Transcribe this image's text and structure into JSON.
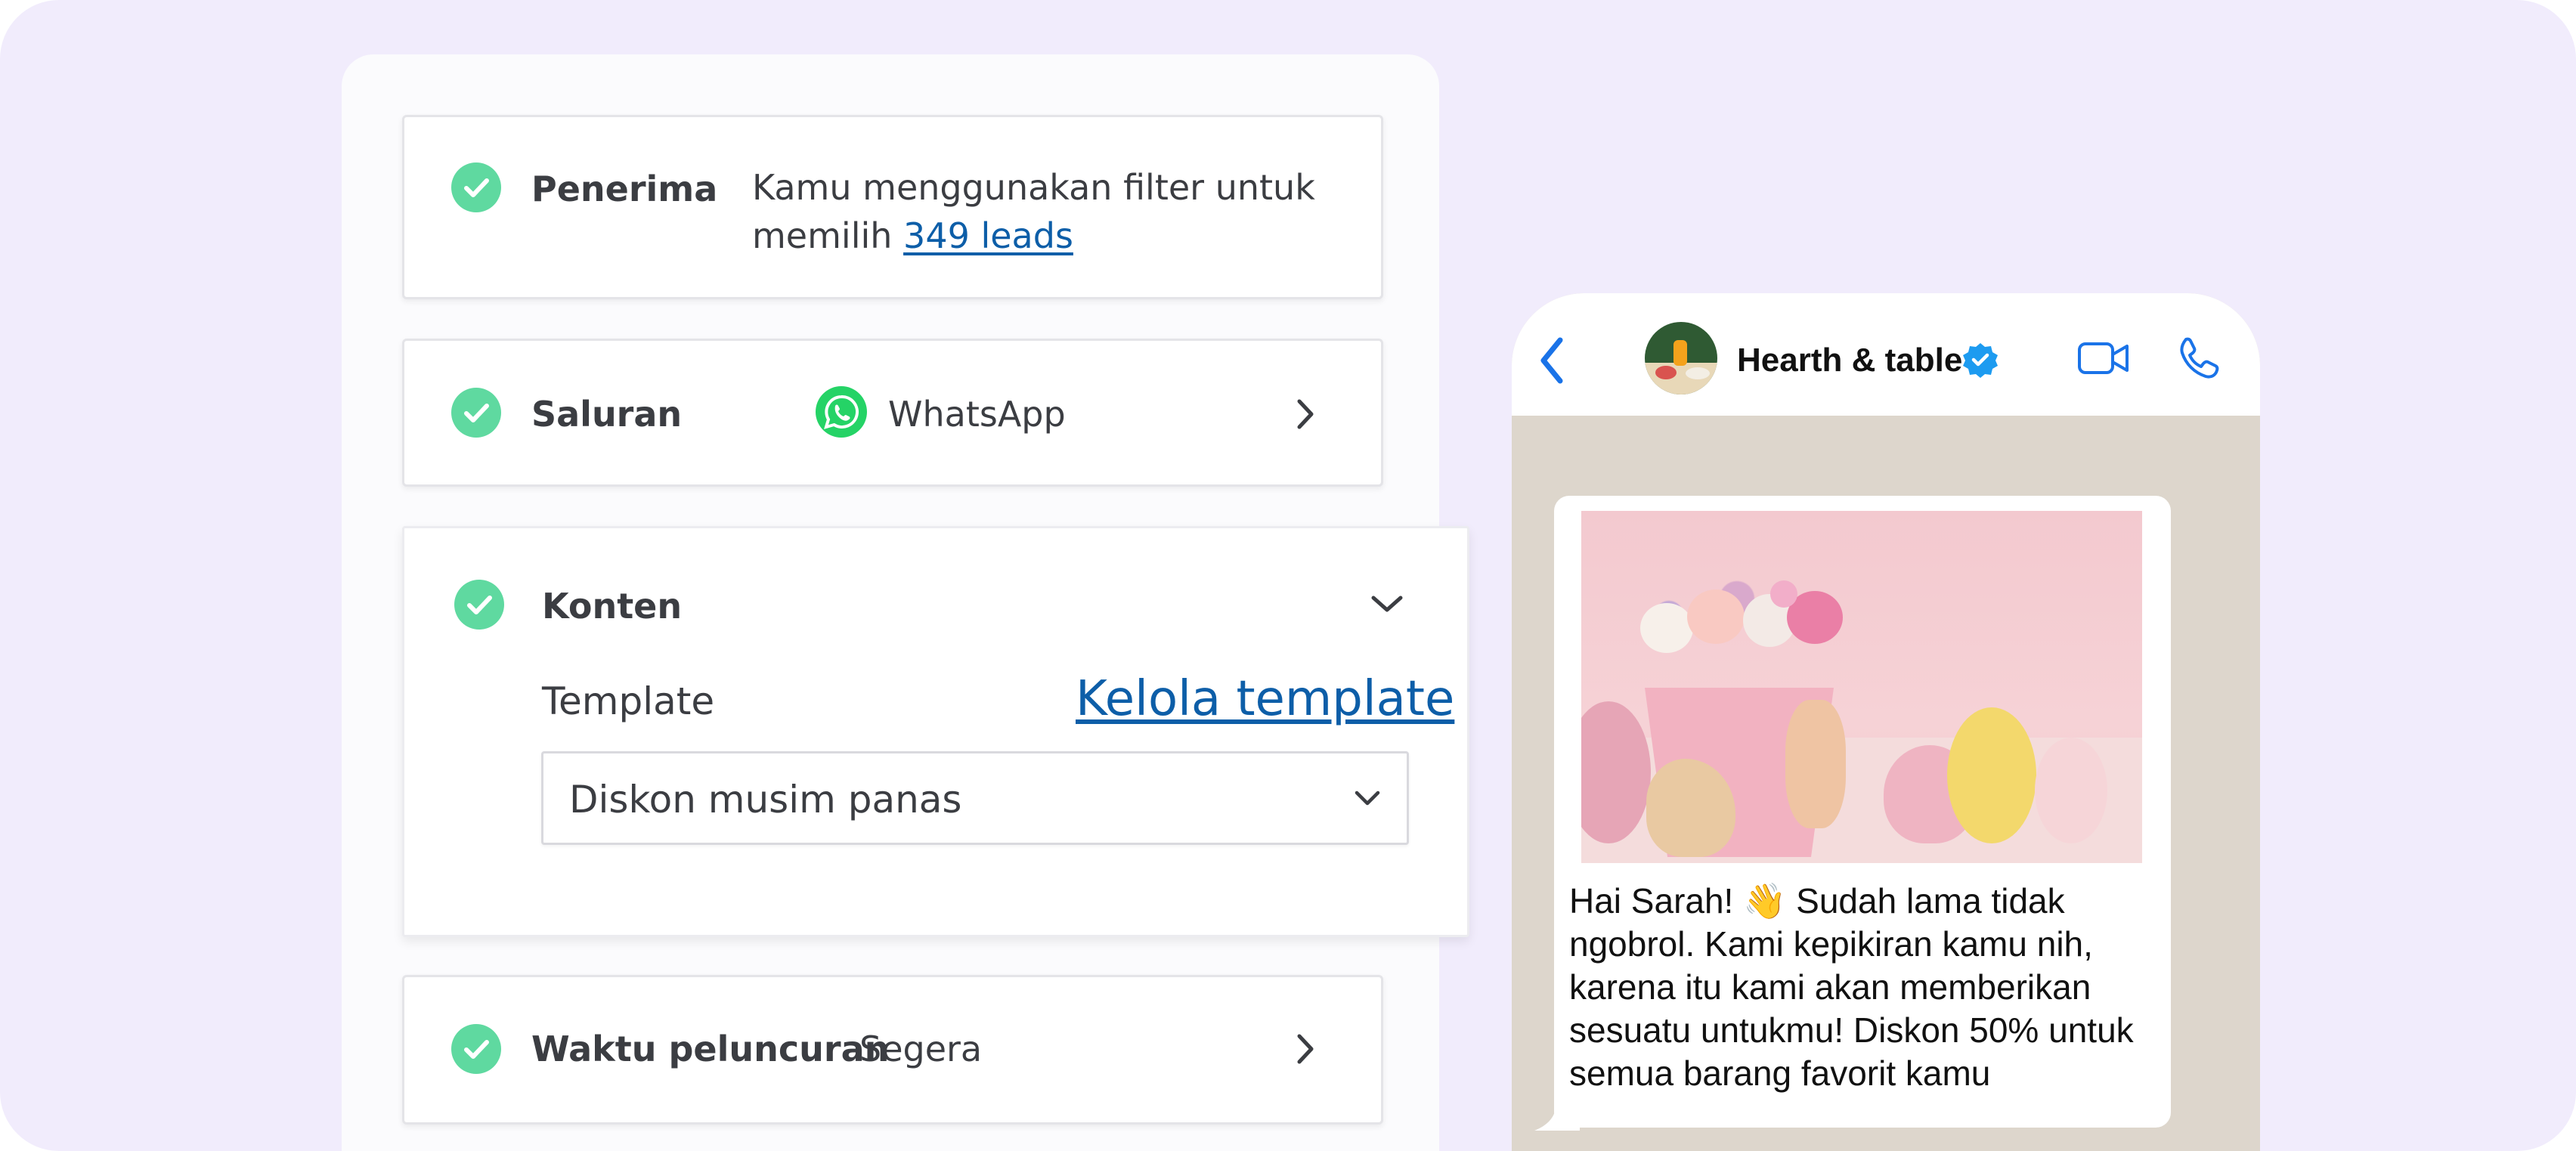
{
  "colors": {
    "background": "#f1ecfc",
    "check_green": "#5fd9a0",
    "link_blue": "#0d5ea8",
    "whatsapp_green": "#25d366",
    "ios_blue": "#1a73e8",
    "verified_blue": "#1d9bf0"
  },
  "steps": {
    "recipients": {
      "label": "Penerima",
      "desc_prefix": "Kamu menggunakan filter untuk",
      "desc_mid": "memilih ",
      "leads_link": "349 leads"
    },
    "channel": {
      "label": "Saluran",
      "value": "WhatsApp",
      "icon": "whatsapp-icon"
    },
    "content": {
      "label": "Konten",
      "template_label": "Template",
      "manage_link": "Kelola template",
      "selected_template": "Diskon musim panas"
    },
    "launch": {
      "label": "Waktu peluncuran",
      "value": "Segera"
    }
  },
  "chat": {
    "contact_name": "Hearth & table",
    "verified_icon": "verified-badge-icon",
    "back_icon": "back-chevron-icon",
    "video_icon": "video-call-icon",
    "phone_icon": "phone-call-icon",
    "image_description_icon": "easter-cookies-photo",
    "message": "Hai Sarah! 👋 Sudah lama tidak ngobrol. Kami kepikiran kamu nih, karena itu kami akan memberikan sesuatu untukmu! Diskon 50% untuk semua barang favorit kamu"
  }
}
